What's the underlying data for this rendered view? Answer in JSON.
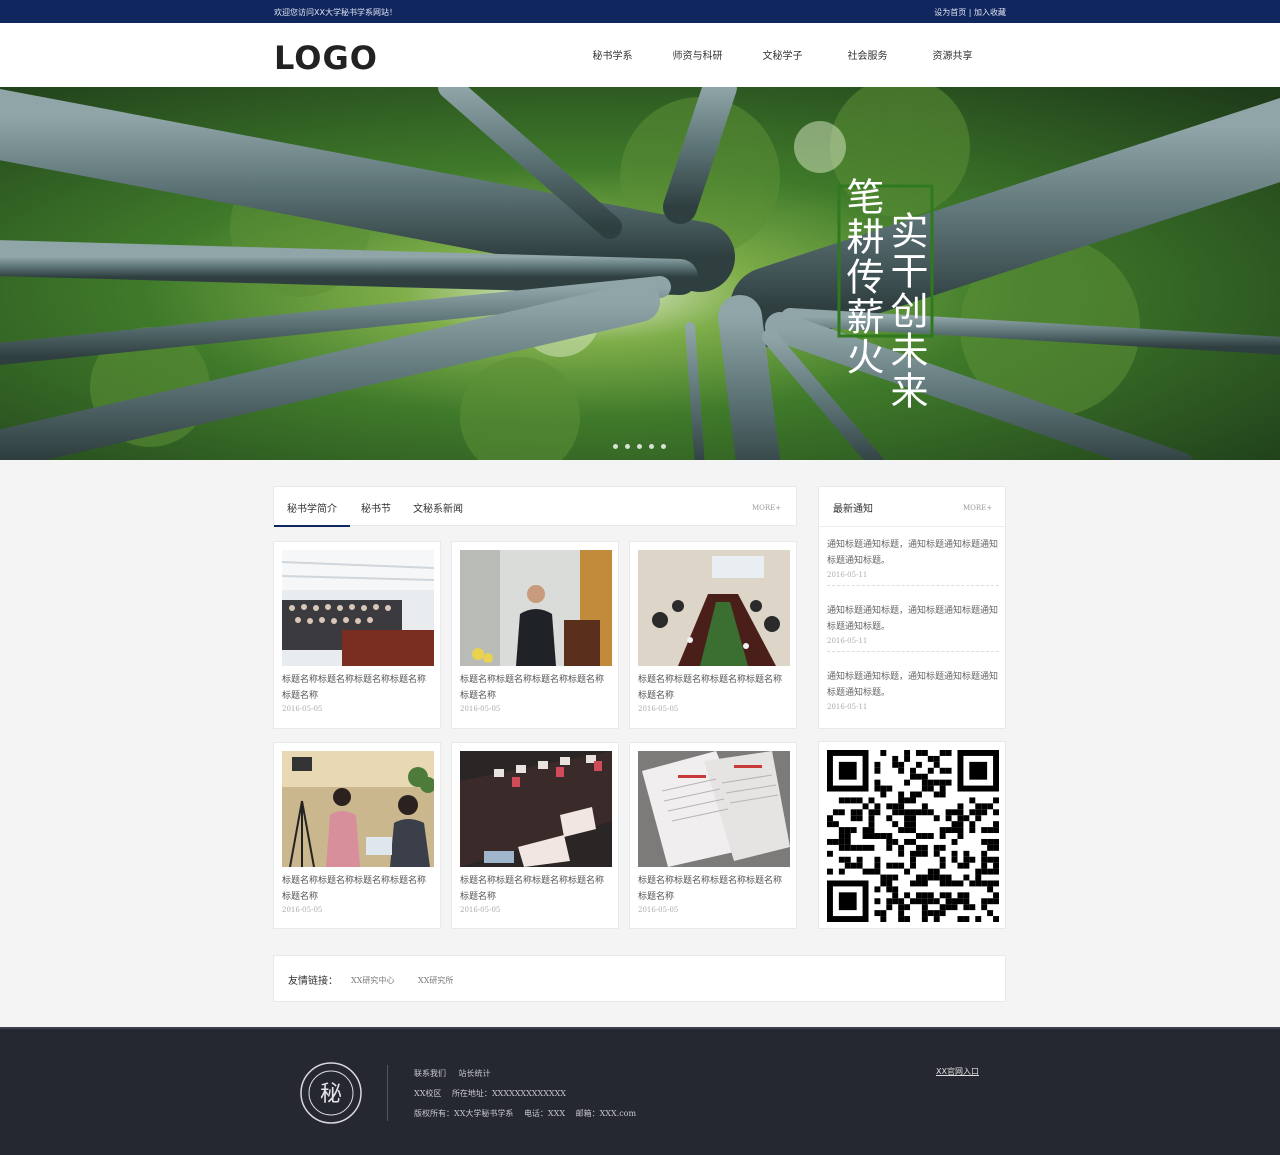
{
  "topbar": {
    "welcome": "欢迎您访问XX大学秘书学系网站！",
    "set_home": "设为首页",
    "separator": "|",
    "favorite": "加入收藏"
  },
  "header": {
    "logo": "LOGO",
    "nav": [
      "秘书学系",
      "师资与科研",
      "文秘学子",
      "社会服务",
      "资源共享"
    ]
  },
  "banner": {
    "slogan_left": "笔耕传薪火",
    "slogan_right": "实干创未来",
    "dot_count": 5
  },
  "news": {
    "tabs": [
      "秘书学简介",
      "秘书节",
      "文秘系新闻"
    ],
    "active_tab": 0,
    "more": "MORE+",
    "cards": [
      {
        "title": "标题名称标题名称标题名称标题名称标题名称",
        "date": "2016-05-05",
        "image": "conference-hall-photo"
      },
      {
        "title": "标题名称标题名称标题名称标题名称标题名称",
        "date": "2016-05-05",
        "image": "lecturer-photo"
      },
      {
        "title": "标题名称标题名称标题名称标题名称标题名称",
        "date": "2016-05-05",
        "image": "meeting-table-photo"
      },
      {
        "title": "标题名称标题名称标题名称标题名称标题名称",
        "date": "2016-05-05",
        "image": "camera-classroom-photo"
      },
      {
        "title": "标题名称标题名称标题名称标题名称标题名称",
        "date": "2016-05-05",
        "image": "name-plates-photo"
      },
      {
        "title": "标题名称标题名称标题名称标题名称标题名称",
        "date": "2016-05-05",
        "image": "documents-photo"
      }
    ]
  },
  "notices": {
    "title": "最新通知",
    "more": "MORE+",
    "items": [
      {
        "title": "通知标题通知标题，通知标题通知标题通知标题通知标题。",
        "date": "2016-05-11"
      },
      {
        "title": "通知标题通知标题，通知标题通知标题通知标题通知标题。",
        "date": "2016-05-11"
      },
      {
        "title": "通知标题通知标题，通知标题通知标题通知标题通知标题。",
        "date": "2016-05-11"
      }
    ]
  },
  "friends": {
    "label": "友情链接：",
    "links": [
      "XX研究中心",
      "XX研究所"
    ]
  },
  "footer": {
    "links": [
      "联系我们",
      "站长统计"
    ],
    "campus": "XX校区",
    "address_label": "所在地址：",
    "address": "XXXXXXXXXXXXX",
    "copyright": "版权所有：XX大学秘书学系",
    "phone": "电话：XXX",
    "email": "邮箱：XXX.com",
    "official_link": "XX官网入口",
    "seal_text": "秘"
  },
  "colors": {
    "topbar": "#10265f",
    "footer": "#252731",
    "page_bg": "#f4f4f4"
  }
}
